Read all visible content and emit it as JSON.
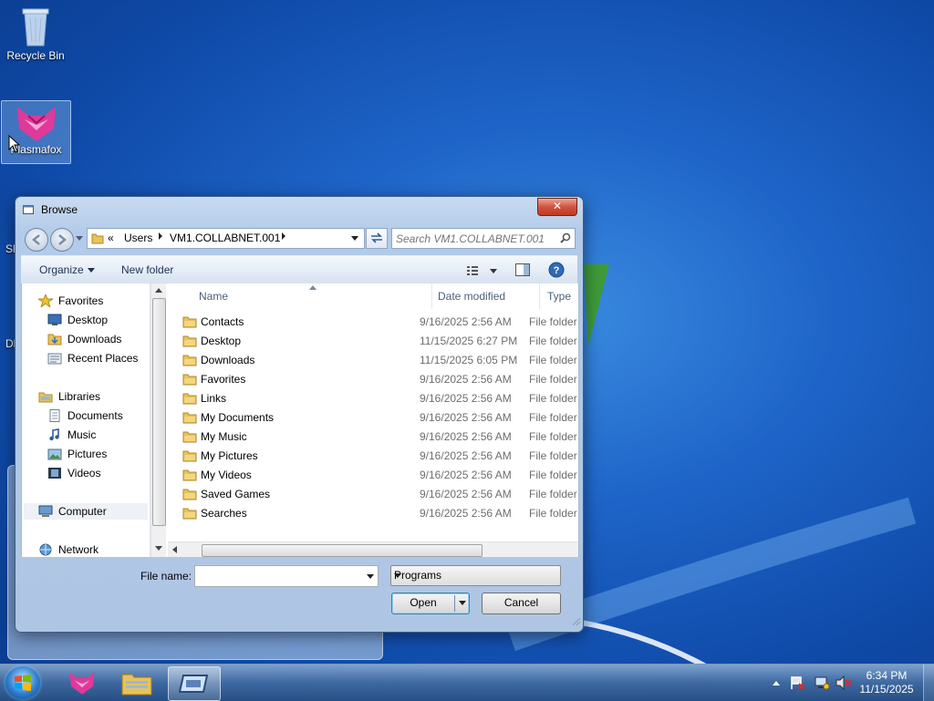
{
  "desktop": {
    "icons": [
      {
        "label": "Recycle Bin"
      },
      {
        "label": "Plasmafox"
      }
    ],
    "edge_texts": [
      "Sl",
      "Dl"
    ]
  },
  "dialog": {
    "title": "Browse",
    "close_label": "✕",
    "address": {
      "overflow": "«",
      "crumbs": [
        "Users",
        "VM1.COLLABNET.001"
      ]
    },
    "search_placeholder": "Search VM1.COLLABNET.001",
    "toolbar": {
      "organize": "Organize",
      "new_folder": "New folder"
    },
    "nav_pane": [
      {
        "label": "Favorites",
        "icon": "star-icon"
      },
      {
        "label": "Desktop",
        "icon": "desktop-icon"
      },
      {
        "label": "Downloads",
        "icon": "downloads-folder-icon"
      },
      {
        "label": "Recent Places",
        "icon": "recent-places-icon"
      },
      {
        "label": "Libraries",
        "icon": "libraries-icon"
      },
      {
        "label": "Documents",
        "icon": "documents-icon"
      },
      {
        "label": "Music",
        "icon": "music-icon"
      },
      {
        "label": "Pictures",
        "icon": "pictures-icon"
      },
      {
        "label": "Videos",
        "icon": "videos-icon"
      },
      {
        "label": "Computer",
        "icon": "computer-icon"
      },
      {
        "label": "Network",
        "icon": "network-icon"
      }
    ],
    "columns": {
      "name": "Name",
      "date": "Date modified",
      "type": "Type"
    },
    "files": [
      {
        "name": "Contacts",
        "date": "9/16/2025 2:56 AM",
        "type": "File folder"
      },
      {
        "name": "Desktop",
        "date": "11/15/2025 6:27 PM",
        "type": "File folder"
      },
      {
        "name": "Downloads",
        "date": "11/15/2025 6:05 PM",
        "type": "File folder"
      },
      {
        "name": "Favorites",
        "date": "9/16/2025 2:56 AM",
        "type": "File folder"
      },
      {
        "name": "Links",
        "date": "9/16/2025 2:56 AM",
        "type": "File folder"
      },
      {
        "name": "My Documents",
        "date": "9/16/2025 2:56 AM",
        "type": "File folder"
      },
      {
        "name": "My Music",
        "date": "9/16/2025 2:56 AM",
        "type": "File folder"
      },
      {
        "name": "My Pictures",
        "date": "9/16/2025 2:56 AM",
        "type": "File folder"
      },
      {
        "name": "My Videos",
        "date": "9/16/2025 2:56 AM",
        "type": "File folder"
      },
      {
        "name": "Saved Games",
        "date": "9/16/2025 2:56 AM",
        "type": "File folder"
      },
      {
        "name": "Searches",
        "date": "9/16/2025 2:56 AM",
        "type": "File folder"
      }
    ],
    "file_name_label": "File name:",
    "file_name_value": "",
    "file_type": "Programs",
    "open_label": "Open",
    "cancel_label": "Cancel"
  },
  "taskbar": {
    "apps": [
      "start-orb",
      "plasmafox-icon",
      "file-explorer-icon",
      "active-window-icon"
    ],
    "clock": {
      "time": "6:34 PM",
      "date": "11/15/2025"
    }
  },
  "colors": {
    "accent": "#3c7fb1",
    "desktop_bg": "#1e64c8",
    "folder": "#e8c35a"
  }
}
